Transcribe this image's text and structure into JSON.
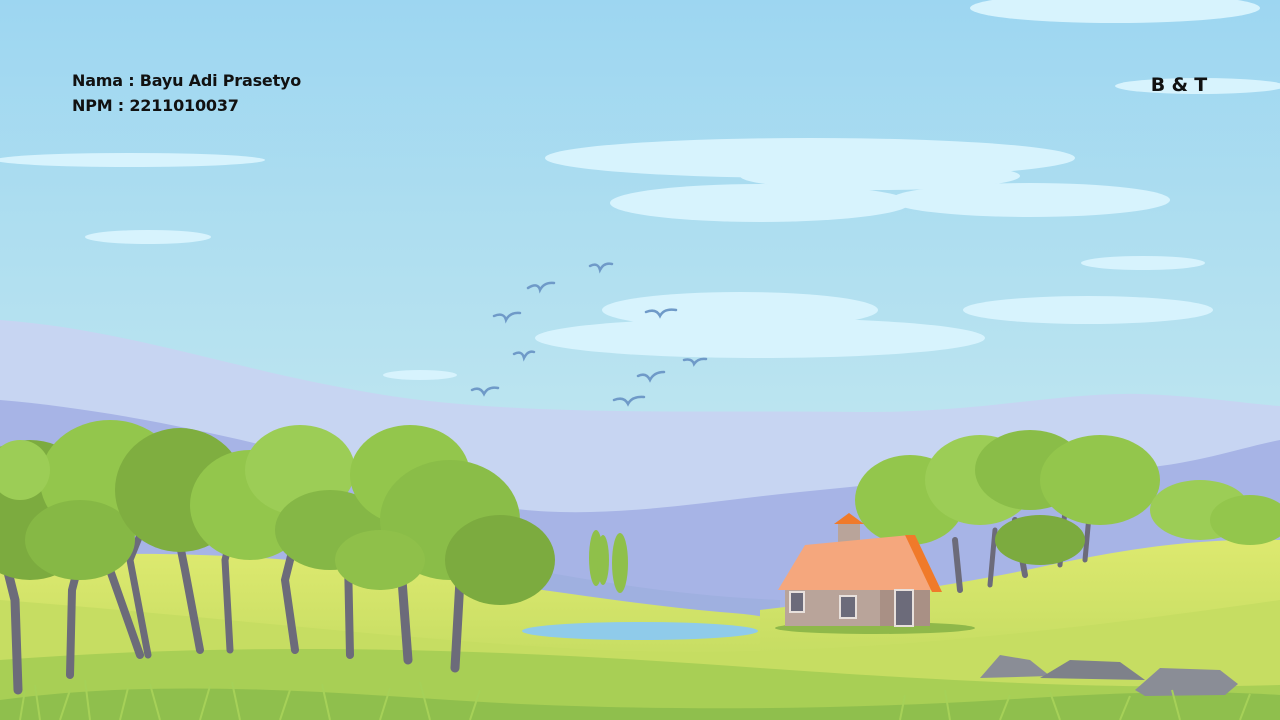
{
  "slide": {
    "name_line": "Nama : Bayu Adi Prasetyo",
    "npm_line": "NPM : 2211010037",
    "brand": "B & T"
  },
  "colors": {
    "sky_top": "#9dd6f1",
    "sky_bottom": "#d2efef",
    "cloud": "#d7f3fd",
    "far_mountain": "#c7d5f2",
    "mid_mountain": "#a7b4e6",
    "hill_light": "#d6e86c",
    "hill_mid": "#b6d65a",
    "grass_dark": "#8fbf4d",
    "tree_light": "#93c64c",
    "tree_dark": "#7cab3f",
    "trunk": "#6c6b7a",
    "roof": "#f5a77d",
    "roof_edge": "#f07a2a",
    "wall": "#b9a49a",
    "pond": "#8fcbea",
    "rock": "#8a8d96",
    "bird": "#6f9ac8"
  }
}
